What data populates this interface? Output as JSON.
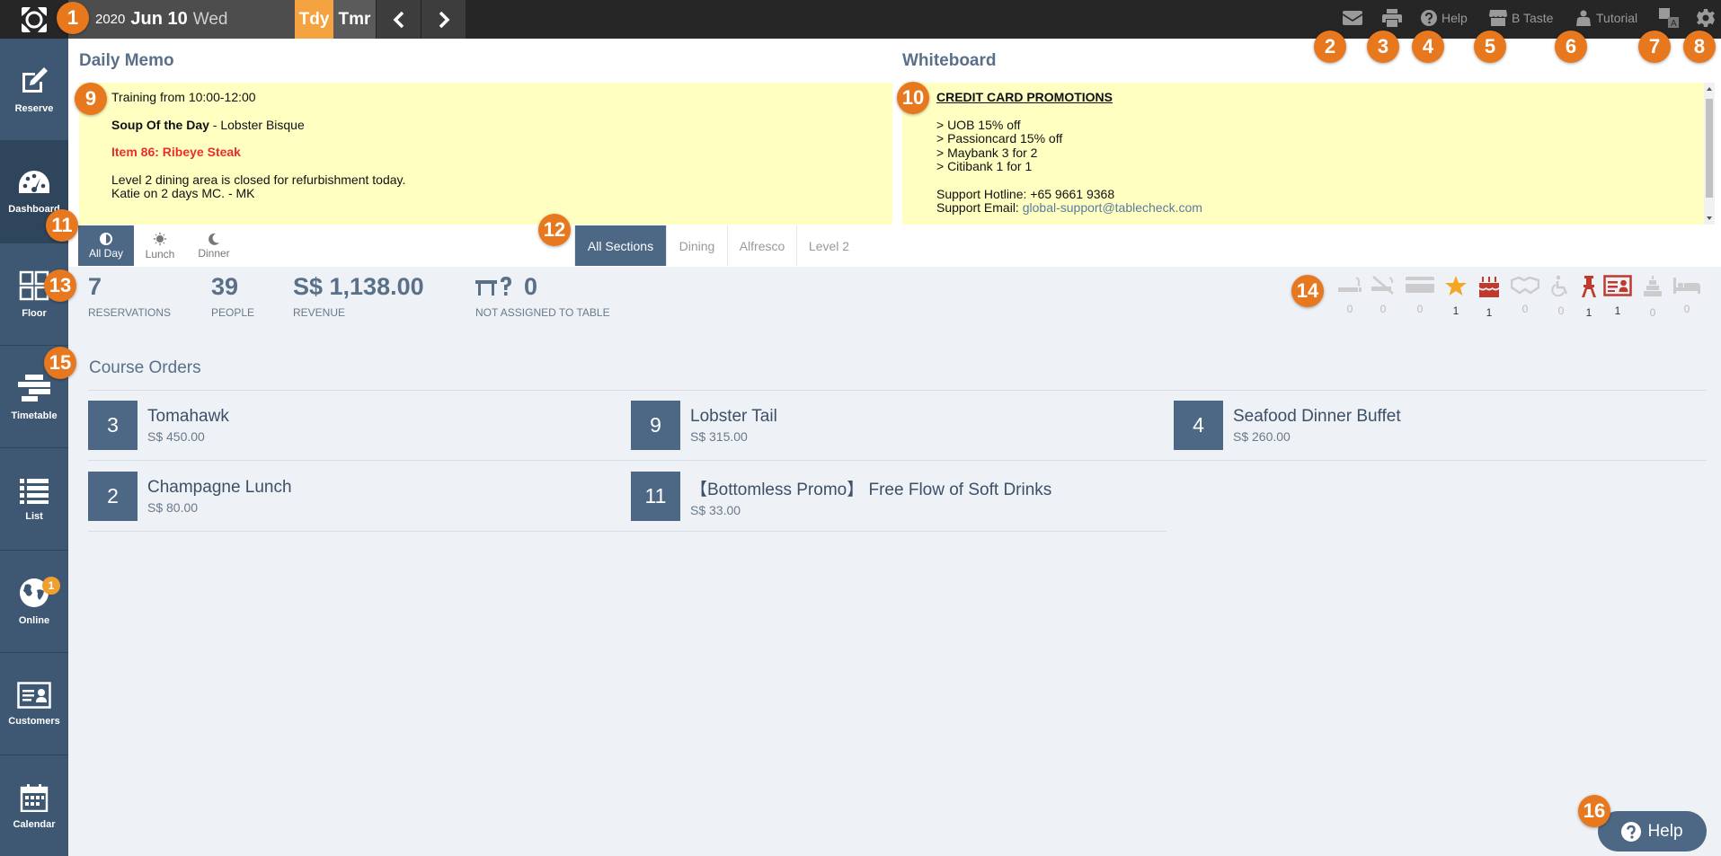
{
  "topbar": {
    "year": "2020",
    "month_day": "Jun 10",
    "weekday": "Wed",
    "today_label": "Tdy",
    "tomorrow_label": "Tmr",
    "right_items": [
      {
        "icon": "mail-icon",
        "label": ""
      },
      {
        "icon": "print-icon",
        "label": ""
      },
      {
        "icon": "help-icon",
        "label": "Help"
      },
      {
        "icon": "store-icon",
        "label": "B Taste"
      },
      {
        "icon": "tutorial-icon",
        "label": "Tutorial"
      },
      {
        "icon": "translate-icon",
        "label": ""
      },
      {
        "icon": "gear-icon",
        "label": ""
      }
    ]
  },
  "sidebar": {
    "items": [
      {
        "label": "Reserve",
        "icon": "edit-icon"
      },
      {
        "label": "Dashboard",
        "icon": "dashboard-icon"
      },
      {
        "label": "Floor",
        "icon": "floor-icon"
      },
      {
        "label": "Timetable",
        "icon": "timetable-icon"
      },
      {
        "label": "List",
        "icon": "list-icon"
      },
      {
        "label": "Online",
        "icon": "globe-icon",
        "badge": "1"
      },
      {
        "label": "Customers",
        "icon": "id-card-icon"
      },
      {
        "label": "Calendar",
        "icon": "calendar-icon"
      }
    ]
  },
  "memo": {
    "title": "Daily Memo",
    "line1": "Training from 10:00-12:00",
    "soup_label": "Soup Of the Day",
    "soup_sep": " - ",
    "soup_value": "Lobster Bisque",
    "item": "Item 86: Ribeye Steak",
    "line4": "Level 2 dining area is closed for refurbishment today.",
    "line5": "Katie on 2 days MC. - MK"
  },
  "whiteboard": {
    "title": "Whiteboard",
    "heading": "CREDIT CARD PROMOTIONS",
    "promos": [
      "> UOB 15% off",
      "> Passioncard 15% off",
      "> Maybank 3 for 2",
      "> Citibank 1 for 1"
    ],
    "hotline": "Support Hotline: +65 9661 9368",
    "email_label": "Support Email: ",
    "email": "global-support@tablecheck.com"
  },
  "meal_tabs": [
    "All Day",
    "Lunch",
    "Dinner"
  ],
  "section_tabs": [
    "All Sections",
    "Dining",
    "Alfresco",
    "Level 2"
  ],
  "stats": {
    "reservations_value": "7",
    "reservations_label": "RESERVATIONS",
    "people_value": "39",
    "people_label": "PEOPLE",
    "revenue_value": "S$ 1,138.00",
    "revenue_label": "REVENUE",
    "unassigned_value": "0",
    "unassigned_label": "NOT ASSIGNED TO TABLE"
  },
  "tag_counts": [
    {
      "icon": "smoking-icon",
      "count": "0"
    },
    {
      "icon": "no-smoking-icon",
      "count": "0"
    },
    {
      "icon": "credit-card-icon",
      "count": "0"
    },
    {
      "icon": "star-icon",
      "count": "1",
      "color": "#f5a623"
    },
    {
      "icon": "birthday-cake-icon",
      "count": "1",
      "color": "#c0392b"
    },
    {
      "icon": "handshake-icon",
      "count": "0"
    },
    {
      "icon": "wheelchair-icon",
      "count": "0"
    },
    {
      "icon": "high-chair-icon",
      "count": "1",
      "color": "#c0392b"
    },
    {
      "icon": "id-card-icon",
      "count": "1",
      "color": "#c0392b"
    },
    {
      "icon": "cake-tier-icon",
      "count": "0"
    },
    {
      "icon": "bed-icon",
      "count": "0"
    }
  ],
  "course_orders": {
    "title": "Course Orders",
    "items": [
      {
        "count": "3",
        "name": "Tomahawk",
        "price": "S$ 450.00"
      },
      {
        "count": "9",
        "name": "Lobster Tail",
        "price": "S$ 315.00"
      },
      {
        "count": "4",
        "name": "Seafood Dinner Buffet",
        "price": "S$ 260.00"
      },
      {
        "count": "2",
        "name": "Champagne Lunch",
        "price": "S$ 80.00"
      },
      {
        "count": "11",
        "name": "【Bottomless Promo】 Free Flow of Soft Drinks",
        "price": "S$ 33.00"
      }
    ]
  },
  "help_button": "Help",
  "markers": [
    "1",
    "2",
    "3",
    "4",
    "5",
    "6",
    "7",
    "8",
    "9",
    "10",
    "11",
    "12",
    "13",
    "14",
    "15",
    "16"
  ]
}
